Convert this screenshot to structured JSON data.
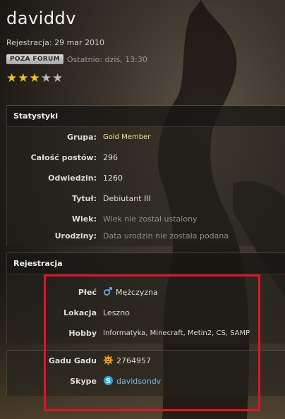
{
  "profile": {
    "username": "daviddv",
    "registration": "Rejestracja: 29 mar 2010",
    "status_badge": "POZA FORUM",
    "last_seen": "Ostatnio: dziś, 13:30",
    "rating": {
      "filled": 3,
      "total": 5
    }
  },
  "stats": {
    "title": "Statystyki",
    "rows": [
      {
        "label": "Grupa:",
        "value": "Gold Member"
      },
      {
        "label": "Całość postów:",
        "value": "296"
      },
      {
        "label": "Odwiedzin:",
        "value": "1260"
      },
      {
        "label": "Tytuł:",
        "value": "Debiutant III"
      },
      {
        "label": "Wiek:",
        "value": "Wiek nie został ustalony"
      },
      {
        "label": "Urodziny:",
        "value": "Data urodzin nie została podana"
      }
    ]
  },
  "registration": {
    "title": "Rejestracja",
    "rows": [
      {
        "label": "Płeć",
        "value": "Mężczyzna",
        "icon": "male-icon"
      },
      {
        "label": "Lokacja",
        "value": "Leszno"
      },
      {
        "label": "Hobby",
        "value": "Informatyka, Minecraft, Metin2, CS, SAMP"
      }
    ]
  },
  "contact": {
    "rows": [
      {
        "label": "Gadu Gadu",
        "value": "2764957",
        "icon": "gadu-gadu-icon"
      },
      {
        "label": "Skype",
        "value": "davidsondv",
        "icon": "skype-icon"
      }
    ]
  },
  "colors": {
    "highlight_border": "#e3122a",
    "gold_text": "#f3e58a",
    "link_text": "#7fb8e6",
    "star_filled": "#f2c21b",
    "star_empty": "#b9b9b9"
  }
}
